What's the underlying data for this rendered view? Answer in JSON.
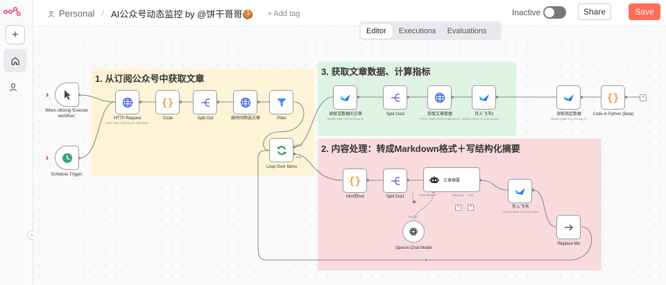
{
  "breadcrumb": {
    "project": "Personal",
    "separator": "/",
    "title": "AI公众号动态监控 by @饼干哥哥🍪",
    "add_tag": "+ Add tag"
  },
  "header": {
    "status_label": "Inactive",
    "share_label": "Share",
    "save_label": "Save"
  },
  "tabs": [
    "Editor",
    "Executions",
    "Evaluations"
  ],
  "colors": {
    "accent": "#ff6d5a",
    "zone_yellow": "#fdf3d6",
    "zone_green": "#dff3e3",
    "zone_red": "#f9dadd"
  },
  "zones": [
    {
      "title": "1. 从订阅公众号中获取文章"
    },
    {
      "title": "3. 获取文章数据、计算指标"
    },
    {
      "title": "2. 内容处理：转成Markdown格式＋写结构化摘要"
    }
  ],
  "nodes": {
    "manual_trigger": {
      "label": "When clicking 'Execute workflow'",
      "icon": "cursor-icon"
    },
    "schedule_trigger": {
      "label": "Schedule Trigger",
      "icon": "clock-icon"
    },
    "http_request": {
      "label": "HTTP Request",
      "sub": "GET: http://152.53.62.162:808...",
      "icon": "globe-icon"
    },
    "code": {
      "label": "Code",
      "icon": "braces-icon"
    },
    "split_out": {
      "label": "Split Out",
      "icon": "split-icon"
    },
    "time_filter": {
      "label": "按时间筛选文章",
      "icon": "globe-icon"
    },
    "filter": {
      "label": "Filter",
      "icon": "filter-icon"
    },
    "loop": {
      "label": "Loop Over Items",
      "loop_done": "done",
      "loop_loop": "loop",
      "icon": "refresh-icon"
    },
    "read_unread": {
      "label": "读取没数据的文章",
      "sub": "bitable:table:record:search",
      "icon": "feishu-icon"
    },
    "split_out2": {
      "label": "Split Out2",
      "icon": "split-icon"
    },
    "get_data": {
      "label": "获取文章数据",
      "sub": "POST: https://www.dajiala.co...bitable:table:record:update",
      "icon": "globe-icon"
    },
    "save_feishu1": {
      "label": "存入飞书1",
      "icon": "feishu-icon"
    },
    "read_specific": {
      "label": "读取指定数据",
      "sub": "bitable:table:record:search",
      "icon": "feishu-icon"
    },
    "code_python": {
      "label": "Code in Python (Beta)",
      "icon": "braces-icon"
    },
    "html_md": {
      "label": "html转md",
      "icon": "braces-icon"
    },
    "split_out1": {
      "label": "Split Out1",
      "icon": "split-icon"
    },
    "agent": {
      "label": "文章摘要",
      "port_model": "Chat Model*",
      "port_memory": "Memory",
      "port_tool": "Tool",
      "icon": "robot-icon"
    },
    "save_feishu": {
      "label": "存入飞书",
      "sub": "bitable:table:record:create",
      "icon": "feishu-icon"
    },
    "replace_me": {
      "label": "Replace Me",
      "icon": "arrow-right-icon"
    },
    "openai": {
      "label": "OpenAI Chat Model",
      "port_model": "Model",
      "icon": "openai-icon"
    }
  }
}
